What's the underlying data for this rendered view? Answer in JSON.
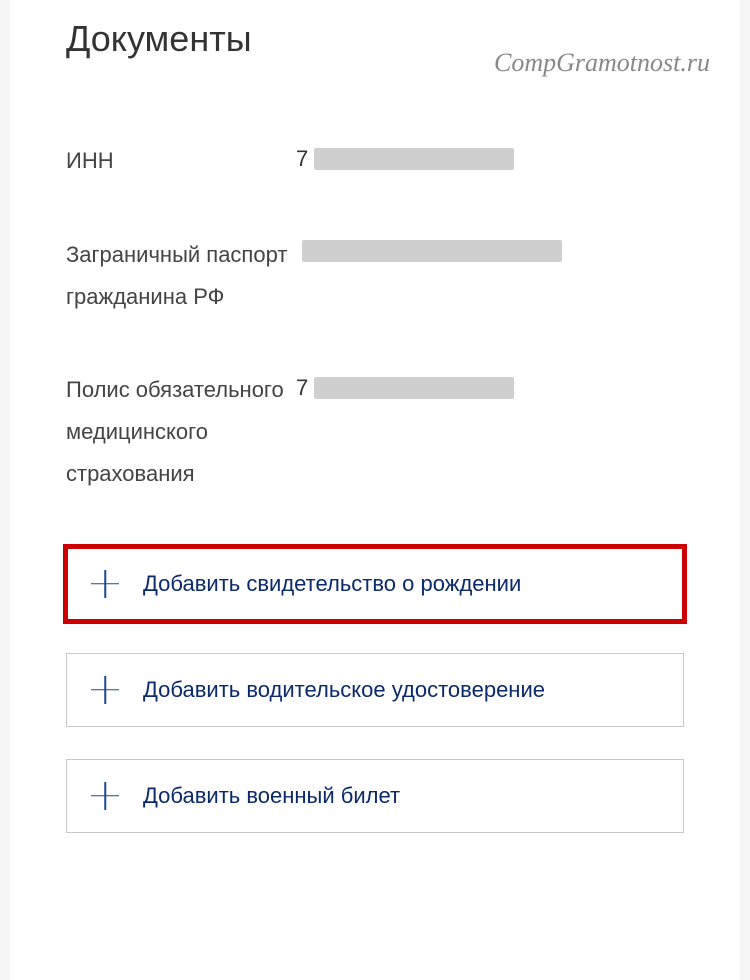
{
  "page": {
    "title": "Документы",
    "watermark": "CompGramotnost.ru"
  },
  "documents": [
    {
      "label": "ИНН",
      "value_prefix": "7"
    },
    {
      "label": "Заграничный паспорт гражданина РФ",
      "value_prefix": ""
    },
    {
      "label": "Полис обязательного медицинского страхования",
      "value_prefix": "7"
    }
  ],
  "add_buttons": [
    {
      "label": "Добавить свидетельство о рождении",
      "highlighted": true
    },
    {
      "label": "Добавить водительское удостоверение",
      "highlighted": false
    },
    {
      "label": "Добавить военный билет",
      "highlighted": false
    }
  ]
}
